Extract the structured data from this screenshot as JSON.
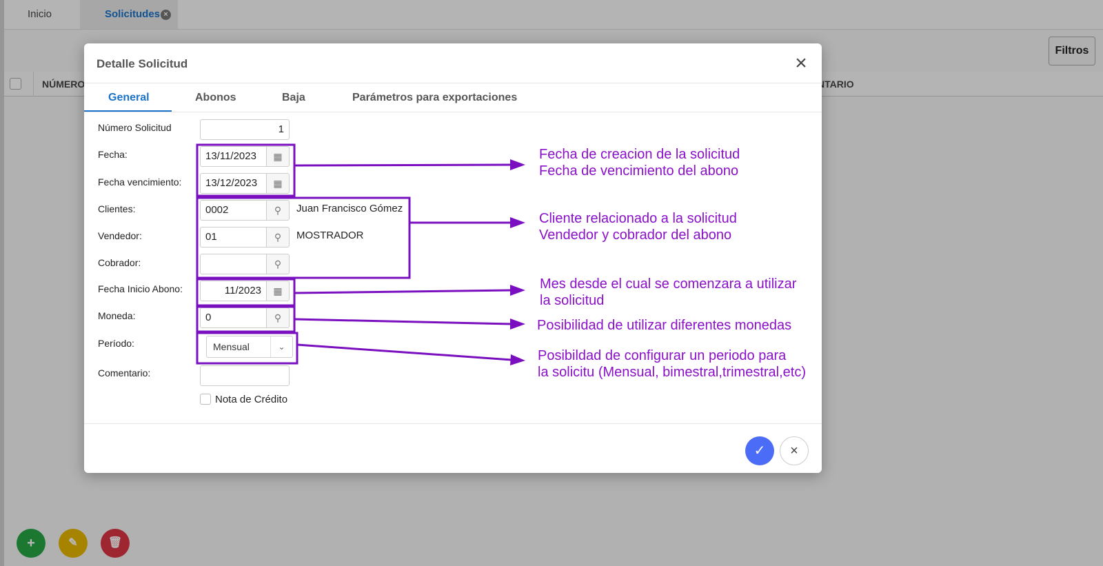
{
  "app": {
    "tabs": [
      {
        "label": "Inicio"
      },
      {
        "label": "Solicitudes",
        "close_icon": "×"
      }
    ],
    "filters_button": "Filtros",
    "grid_headers": {
      "numero": "NÚMERO",
      "comentario": "NTARIO"
    },
    "actions": {
      "add": "+",
      "edit": "✎",
      "delete": "🗑"
    }
  },
  "dialog": {
    "title": "Detalle Solicitud",
    "close_icon": "×",
    "tabs": [
      {
        "label": "General",
        "active": true
      },
      {
        "label": "Abonos"
      },
      {
        "label": "Baja"
      },
      {
        "label": "Parámetros para exportaciones"
      }
    ],
    "fields": {
      "numero": {
        "label": "Número Solicitud",
        "value": "1"
      },
      "fecha": {
        "label": "Fecha:",
        "value": "13/11/2023"
      },
      "fecha_venc": {
        "label": "Fecha vencimiento:",
        "value": "13/12/2023"
      },
      "clientes": {
        "label": "Clientes:",
        "value": "0002",
        "name": "Juan Francisco Gómez"
      },
      "vendedor": {
        "label": "Vendedor:",
        "value": "01",
        "name": "MOSTRADOR"
      },
      "cobrador": {
        "label": "Cobrador:",
        "value": ""
      },
      "fecha_inicio": {
        "label": "Fecha Inicio Abono:",
        "value": "11/2023"
      },
      "moneda": {
        "label": "Moneda:",
        "value": "0"
      },
      "periodo": {
        "label": "Período:",
        "value": "Mensual"
      },
      "comentario": {
        "label": "Comentario:",
        "value": ""
      },
      "nota_credito": {
        "label": "Nota de Crédito",
        "checked": false
      }
    },
    "ok_icon": "✓",
    "cancel_icon": "×"
  },
  "annotations": {
    "fechas": [
      "Fecha de creacion de la solicitud",
      "Fecha de vencimiento del abono"
    ],
    "clientes": [
      "Cliente relacionado a la solicitud",
      "Vendedor y cobrador del abono"
    ],
    "inicio": [
      "Mes desde el cual se comenzara a utilizar",
      "la solicitud"
    ],
    "moneda": [
      "Posibilidad de utilizar diferentes monedas"
    ],
    "periodo": [
      "Posibildad de configurar un periodo para",
      "la solicitu (Mensual, bimestral,trimestral,etc)"
    ],
    "color": "#7a0fbf"
  }
}
